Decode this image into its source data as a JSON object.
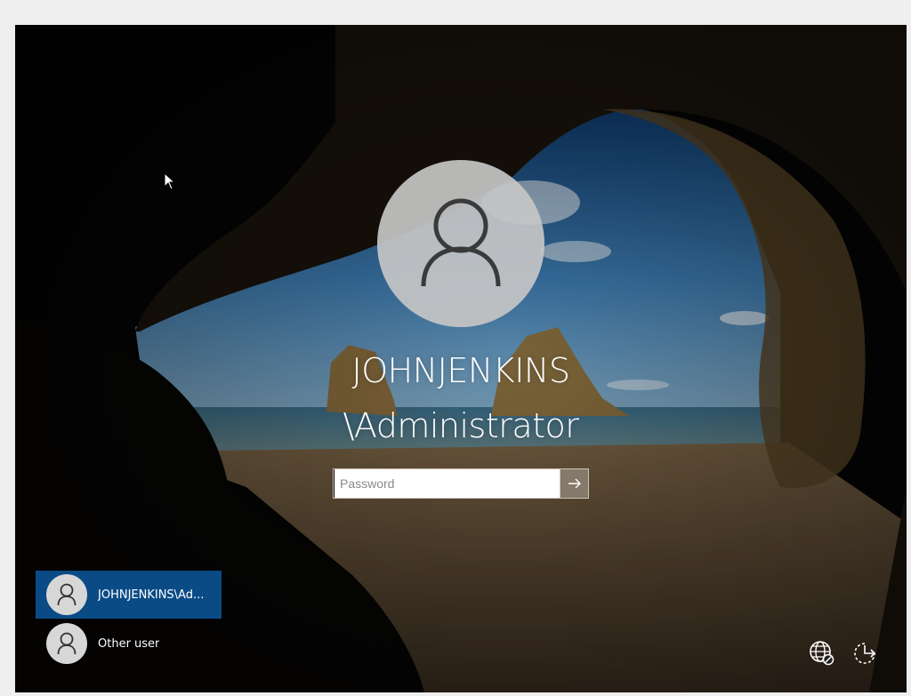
{
  "login": {
    "username_line1": "JOHNJENKINS",
    "username_line2": "\\Administrator",
    "password_placeholder": "Password"
  },
  "user_list": [
    {
      "label": "JOHNJENKINS\\Ad...",
      "selected": true
    },
    {
      "label": "Other user",
      "selected": false
    }
  ],
  "system_icons": [
    "network-icon",
    "ease-of-access-icon"
  ],
  "colors": {
    "selected_tile": "#0a4b86",
    "submit_button": "#786a5c",
    "avatar_bg": "#c6c6c6"
  }
}
